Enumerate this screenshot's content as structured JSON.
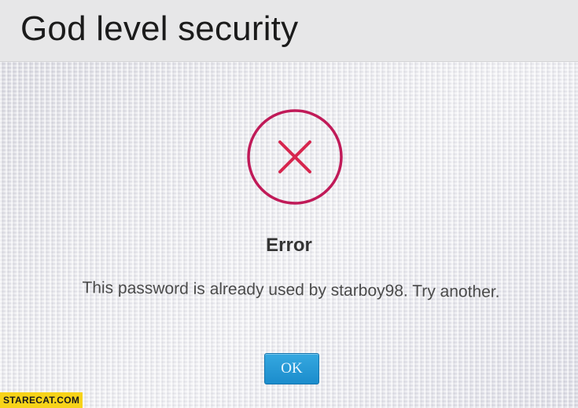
{
  "caption": {
    "title": "God level security"
  },
  "dialog": {
    "title": "Error",
    "message": "This password is already used by starboy98. Try another.",
    "ok_label": "OK",
    "icon": "error-x-circle-icon",
    "colors": {
      "icon": "#c2185b",
      "ok_button": "#229ad6"
    }
  },
  "watermark": {
    "text": "STARECAT.COM",
    "background": "#f7d319"
  }
}
